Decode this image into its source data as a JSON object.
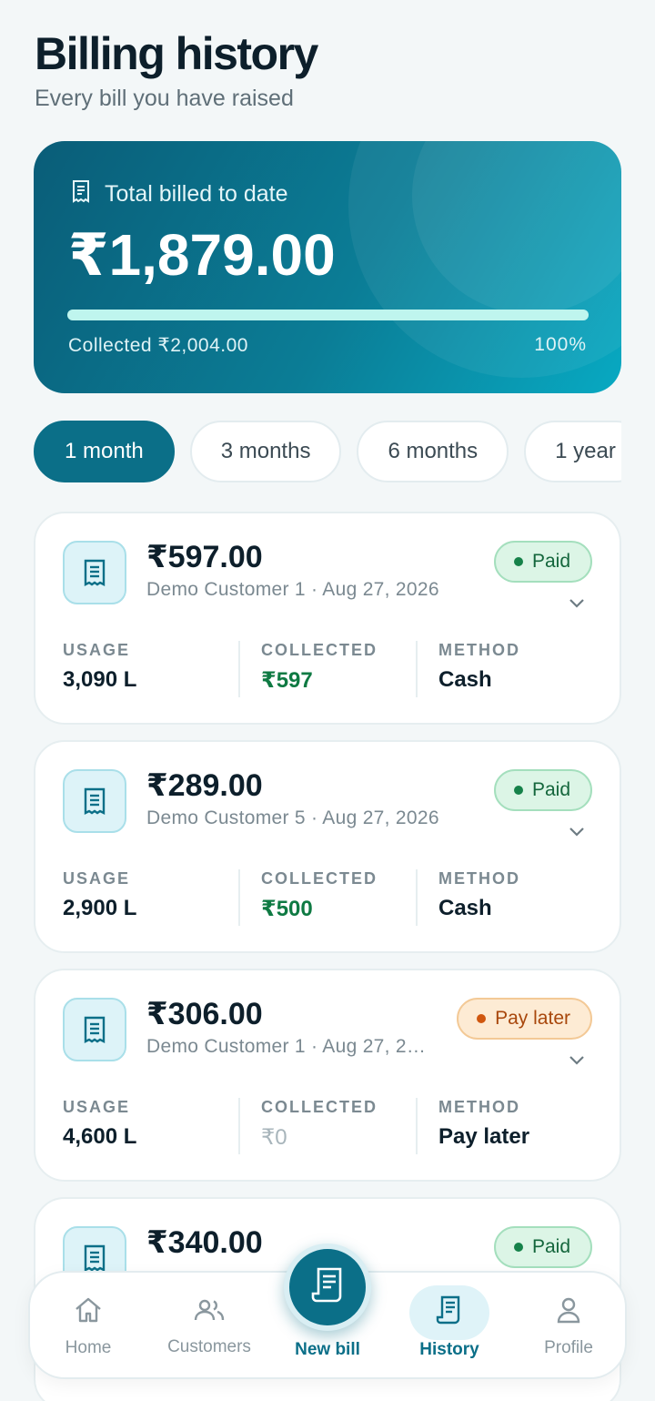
{
  "header": {
    "title": "Billing history",
    "subtitle": "Every bill you have raised"
  },
  "summary": {
    "label": "Total billed to date",
    "amount": "₹1,879.00",
    "collected": "Collected ₹2,004.00",
    "percent": "100%",
    "progress": 1.0
  },
  "filters": [
    {
      "label": "1 month",
      "active": true
    },
    {
      "label": "3 months",
      "active": false
    },
    {
      "label": "6 months",
      "active": false
    },
    {
      "label": "1 year",
      "active": false
    }
  ],
  "bills": [
    {
      "amount": "₹597.00",
      "customer": "Demo Customer 1",
      "date": "Aug 27, 2026",
      "status": "Paid",
      "status_type": "paid",
      "usage_label": "USAGE",
      "usage": "3,090 L",
      "collected_label": "COLLECTED",
      "collected": "₹597",
      "method_label": "METHOD",
      "method": "Cash"
    },
    {
      "amount": "₹289.00",
      "customer": "Demo Customer 5",
      "date": "Aug 27, 2026",
      "status": "Paid",
      "status_type": "paid",
      "usage_label": "USAGE",
      "usage": "2,900 L",
      "collected_label": "COLLECTED",
      "collected": "₹500",
      "method_label": "METHOD",
      "method": "Cash"
    },
    {
      "amount": "₹306.00",
      "customer": "Demo Customer 1",
      "date": "Aug 27, 2…",
      "status": "Pay later",
      "status_type": "later",
      "usage_label": "USAGE",
      "usage": "4,600 L",
      "collected_label": "COLLECTED",
      "collected": "₹0",
      "method_label": "METHOD",
      "method": "Pay later"
    },
    {
      "amount": "₹340.00",
      "status": "Paid",
      "status_type": "paid"
    }
  ],
  "nav": {
    "home": "Home",
    "customers": "Customers",
    "new_bill": "New bill",
    "history": "History",
    "profile": "Profile"
  },
  "colors": {
    "accent": "#0b6f88",
    "paid": "#16824a",
    "pay_later": "#d0570f"
  }
}
